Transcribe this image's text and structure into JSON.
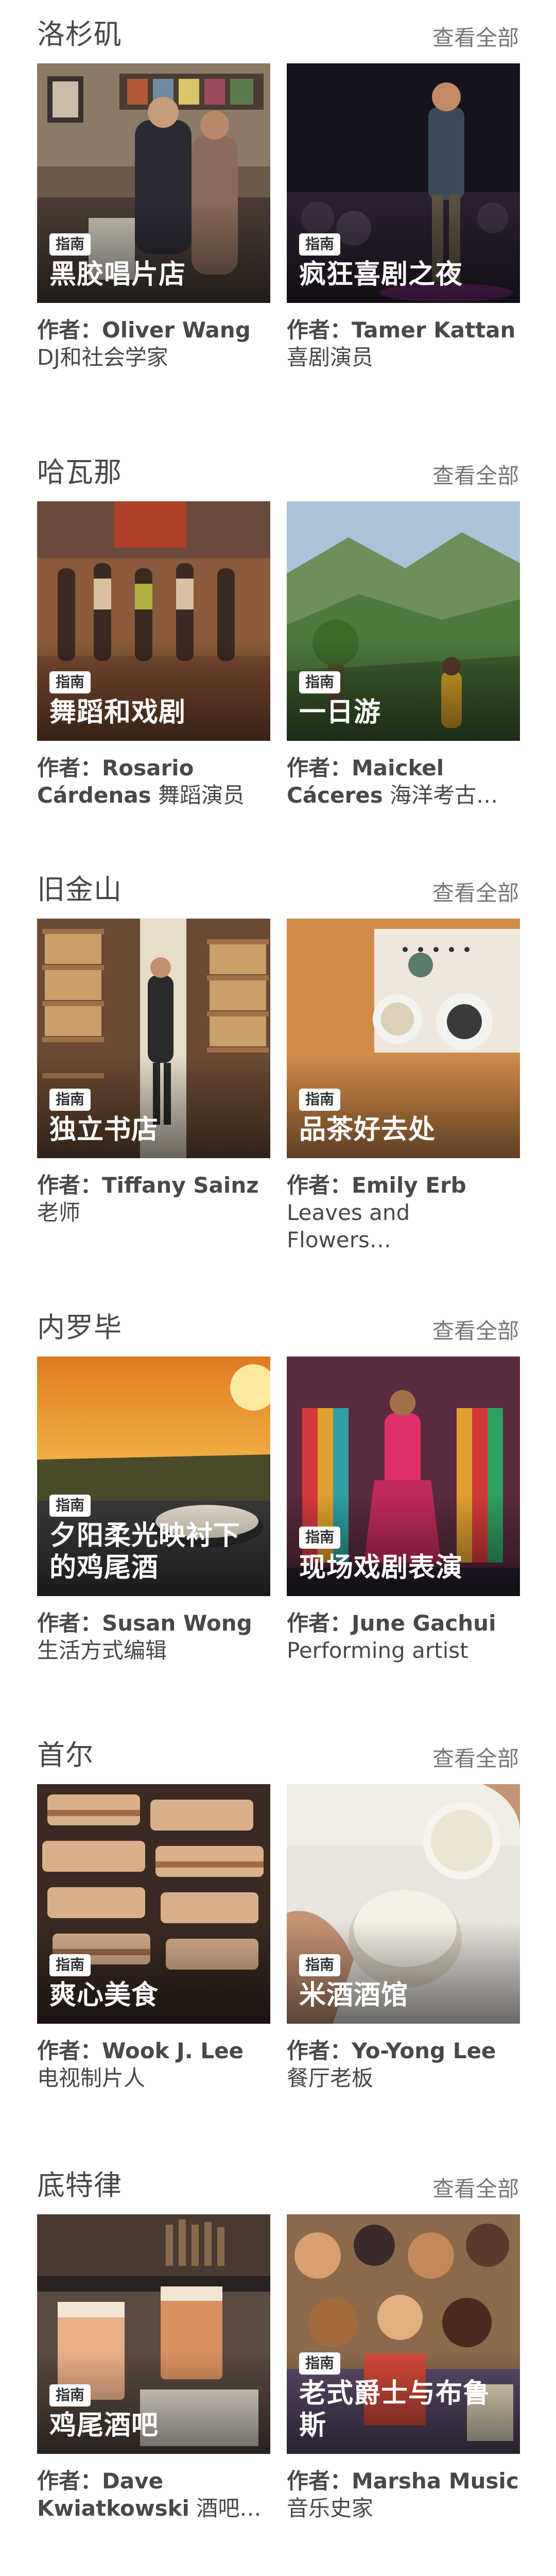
{
  "badge_label": "指南",
  "author_prefix": "作者：",
  "see_all_label": "查看全部",
  "sections": [
    {
      "city": "洛杉矶",
      "cards": [
        {
          "title": "黑胶唱片店",
          "author_name": "Oliver Wang",
          "author_role": "DJ和社会学家"
        },
        {
          "title": "疯狂喜剧之夜",
          "author_name": "Tamer Kattan",
          "author_role": "喜剧演员"
        }
      ]
    },
    {
      "city": "哈瓦那",
      "cards": [
        {
          "title": "舞蹈和戏剧",
          "author_name": "Rosario Cárdenas",
          "author_role": "舞蹈演员"
        },
        {
          "title": "一日游",
          "author_name": "Maickel Cáceres",
          "author_role": "海洋考古…"
        }
      ]
    },
    {
      "city": "旧金山",
      "cards": [
        {
          "title": "独立书店",
          "author_name": "Tiffany Sainz",
          "author_role": "老师"
        },
        {
          "title": "品茶好去处",
          "author_name": "Emily Erb",
          "author_role": "Leaves and Flowers…"
        }
      ]
    },
    {
      "city": "内罗毕",
      "cards": [
        {
          "title": "夕阳柔光映衬下的鸡尾酒",
          "author_name": "Susan Wong",
          "author_role": "生活方式编辑"
        },
        {
          "title": "现场戏剧表演",
          "author_name": "June Gachui",
          "author_role": "Performing artist"
        }
      ]
    },
    {
      "city": "首尔",
      "cards": [
        {
          "title": "爽心美食",
          "author_name": "Wook J. Lee",
          "author_role": "电视制片人"
        },
        {
          "title": "米酒酒馆",
          "author_name": "Yo-Yong Lee",
          "author_role": "餐厅老板"
        }
      ]
    },
    {
      "city": "底特律",
      "cards": [
        {
          "title": "鸡尾酒吧",
          "author_name": "Dave Kwiatkowski",
          "author_role": "酒吧…"
        },
        {
          "title": "老式爵士与布鲁斯",
          "author_name": "Marsha Music",
          "author_role": "音乐史家"
        }
      ]
    }
  ]
}
